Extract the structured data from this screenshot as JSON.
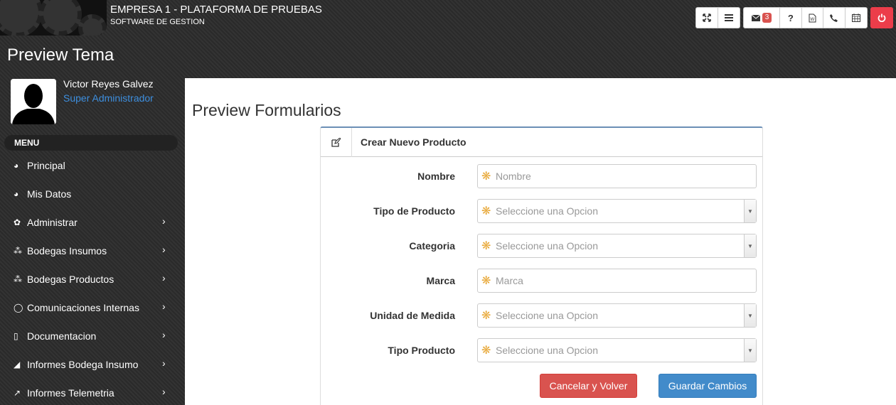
{
  "header": {
    "title": "EMPRESA 1 - PLATAFORMA DE PRUEBAS",
    "subtitle": "SOFTWARE DE GESTION",
    "toolbar": {
      "expand_icon": "expand-icon",
      "menu_icon": "bars-icon",
      "mail_icon": "envelope-icon",
      "mail_count": "3",
      "help_label": "?",
      "word_icon": "file-word-icon",
      "phone_icon": "phone-icon",
      "calendar_icon": "calendar-icon",
      "power_icon": "power-icon"
    },
    "colors": {
      "power": "#ec3d4a",
      "badge": "#d9534f"
    }
  },
  "page_title": "Preview Tema",
  "user": {
    "name": "Victor Reyes Galvez",
    "role": "Super Administrador"
  },
  "sidebar": {
    "menu_label": "MENU",
    "items": [
      {
        "label": "Principal",
        "icon": "dashboard-icon",
        "glyph": "◕",
        "submenu": false
      },
      {
        "label": "Mis Datos",
        "icon": "dashboard-icon",
        "glyph": "◕",
        "submenu": false
      },
      {
        "label": "Administrar",
        "icon": "gear-icon",
        "glyph": "✿",
        "submenu": true
      },
      {
        "label": "Bodegas Insumos",
        "icon": "cubes-icon",
        "glyph": "⁂",
        "submenu": true
      },
      {
        "label": "Bodegas Productos",
        "icon": "cubes-icon",
        "glyph": "⁂",
        "submenu": true
      },
      {
        "label": "Comunicaciones Internas",
        "icon": "whatsapp-icon",
        "glyph": "◯",
        "submenu": true
      },
      {
        "label": "Documentacion",
        "icon": "file-icon",
        "glyph": "▯",
        "submenu": true
      },
      {
        "label": "Informes Bodega Insumo",
        "icon": "area-chart-icon",
        "glyph": "◢",
        "submenu": true
      },
      {
        "label": "Informes Telemetria",
        "icon": "line-chart-icon",
        "glyph": "↗",
        "submenu": true
      }
    ]
  },
  "main": {
    "title": "Preview Formularios",
    "card": {
      "title": "Crear Nuevo Producto",
      "fields": [
        {
          "label": "Nombre",
          "placeholder": "Nombre",
          "type": "text"
        },
        {
          "label": "Tipo de Producto",
          "placeholder": "Seleccione una Opcion",
          "type": "select"
        },
        {
          "label": "Categoria",
          "placeholder": "Seleccione una Opcion",
          "type": "select"
        },
        {
          "label": "Marca",
          "placeholder": "Marca",
          "type": "text"
        },
        {
          "label": "Unidad de Medida",
          "placeholder": "Seleccione una Opcion",
          "type": "select"
        },
        {
          "label": "Tipo Producto",
          "placeholder": "Seleccione una Opcion",
          "type": "select"
        }
      ],
      "cancel_label": "Cancelar y Volver",
      "save_label": "Guardar Cambios"
    }
  }
}
